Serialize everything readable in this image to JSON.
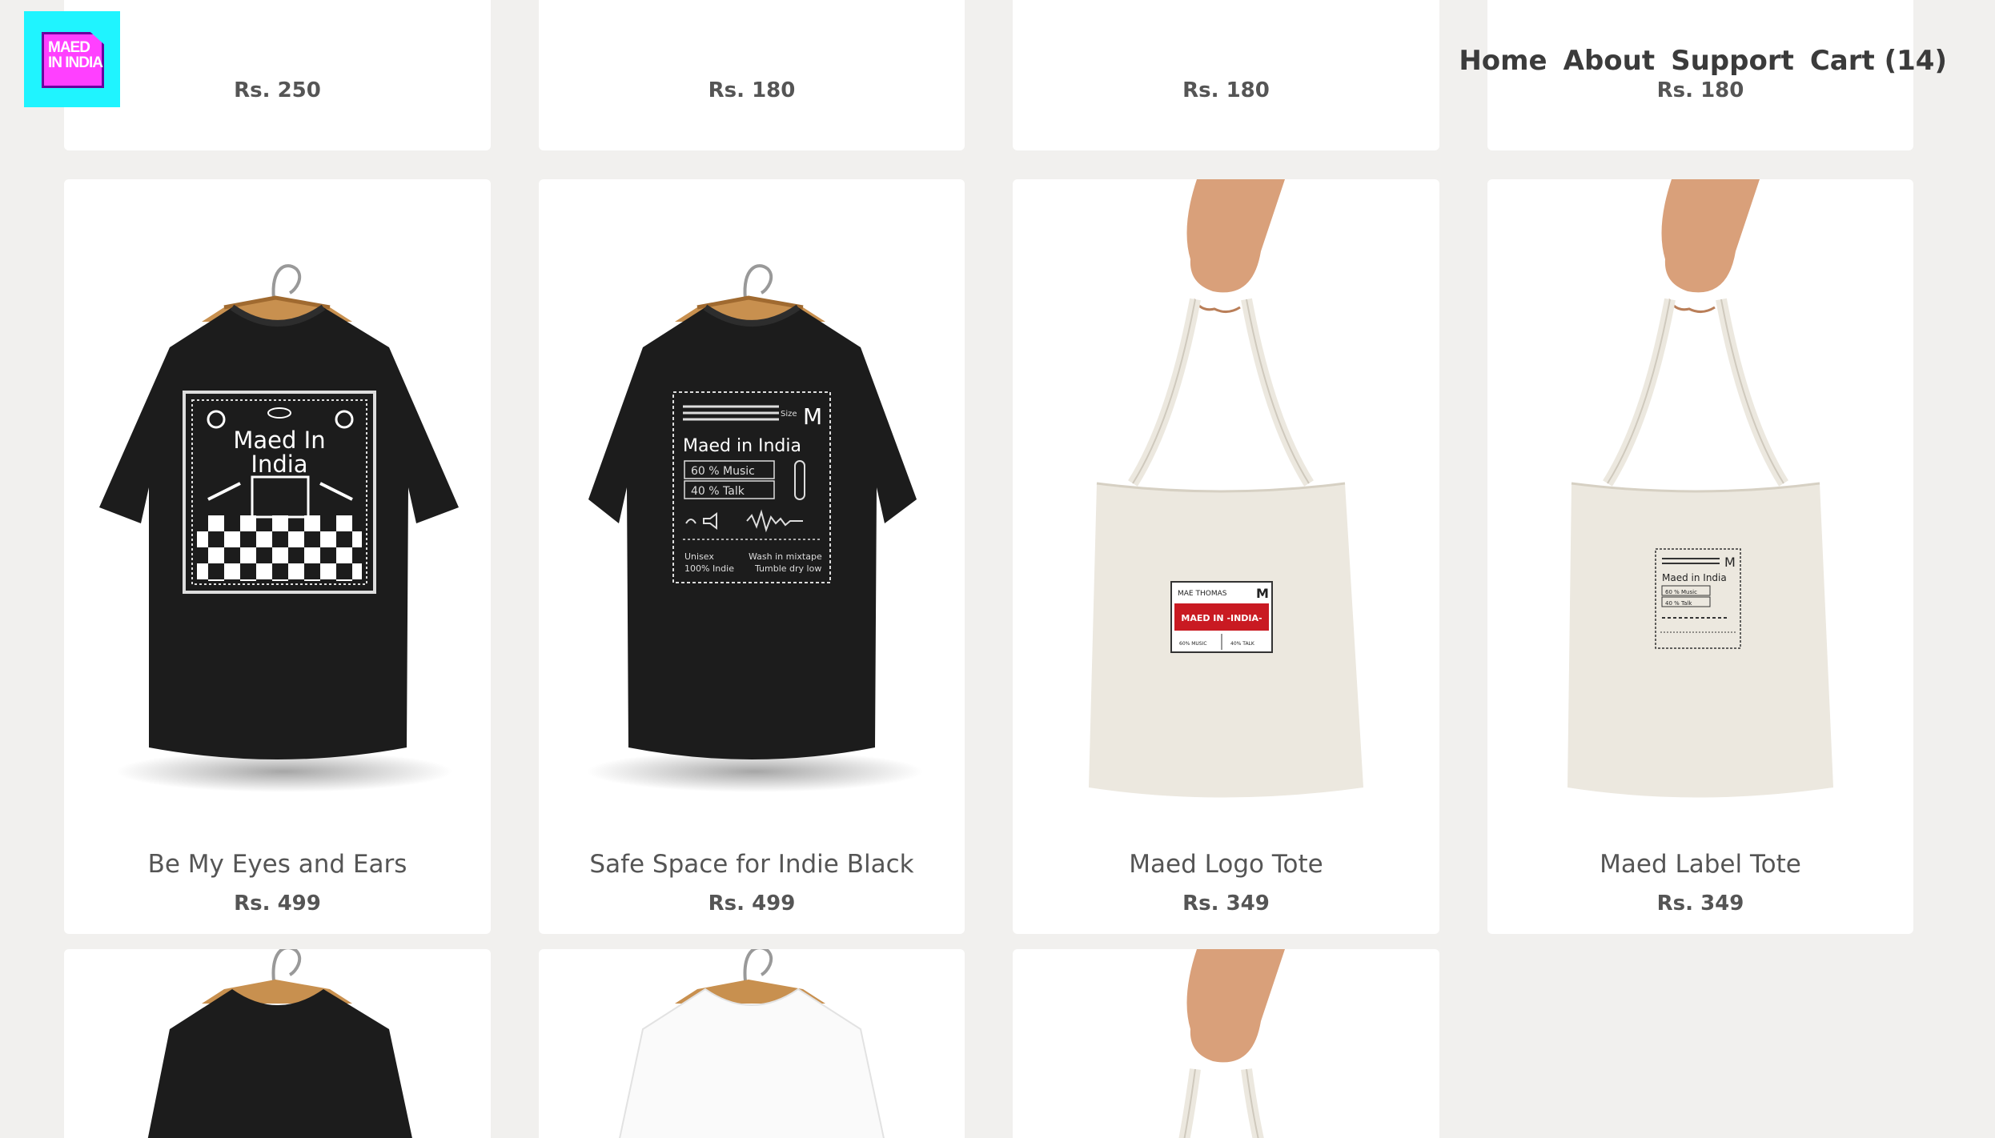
{
  "brand": {
    "logo_text_line1": "MAED",
    "logo_text_line2": "IN INDIA",
    "accent": "#1ff4ff",
    "logo_color": "#ff40ff"
  },
  "nav": [
    {
      "label": "Home"
    },
    {
      "label": "About"
    },
    {
      "label": "Support"
    },
    {
      "label": "Cart (14)"
    }
  ],
  "products_top": [
    {
      "price": "Rs. 250"
    },
    {
      "price": "Rs. 180"
    },
    {
      "price": "Rs. 180"
    },
    {
      "price": "Rs. 180"
    }
  ],
  "products": [
    {
      "title": "Be My Eyes and Ears",
      "price": "Rs. 499",
      "kind": "black-tshirt-checker",
      "print_line1": "Maed In",
      "print_line2": "India"
    },
    {
      "title": "Safe Space for Indie Black",
      "price": "Rs. 499",
      "kind": "black-tshirt-label",
      "print_heading": "Maed in India",
      "print_size": "Size",
      "print_m": "M",
      "print_music": "60 % Music",
      "print_talk": "40 % Talk",
      "print_unisex": "Unisex",
      "print_indie": "100% Indie",
      "print_wash": "Wash in mixtape",
      "print_dry": "Tumble dry low"
    },
    {
      "title": "Maed Logo Tote",
      "price": "Rs. 349",
      "kind": "tote-logo",
      "print_name": "MAE THOMAS",
      "print_m": "M",
      "print_banner": "MAED IN -INDIA-",
      "print_music": "60% MUSIC",
      "print_talk": "40% TALK"
    },
    {
      "title": "Maed Label Tote",
      "price": "Rs. 349",
      "kind": "tote-label",
      "print_heading": "Maed in India",
      "print_m": "M",
      "print_music": "60 % Music",
      "print_talk": "40 % Talk"
    }
  ],
  "products_bottom": [
    {
      "kind": "black-tshirt"
    },
    {
      "kind": "white-tshirt"
    },
    {
      "kind": "tote"
    }
  ]
}
